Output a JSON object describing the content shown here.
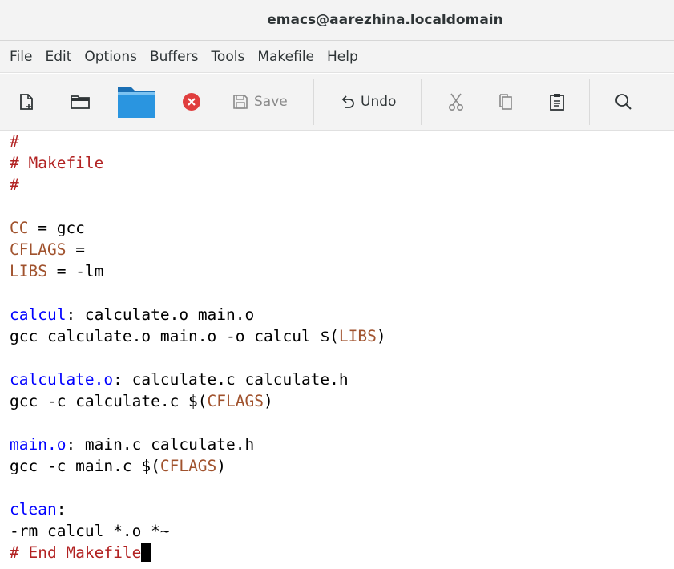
{
  "window": {
    "title": "emacs@aarezhina.localdomain"
  },
  "menu": [
    "File",
    "Edit",
    "Options",
    "Buffers",
    "Tools",
    "Makefile",
    "Help"
  ],
  "toolbar": {
    "new_file_icon": "new-file-icon",
    "open_icon": "folder-icon",
    "dired_icon": "folder-blue-icon",
    "close_icon": "close-circle-icon",
    "save_label": "Save",
    "undo_label": "Undo",
    "cut_icon": "scissors-icon",
    "copy_icon": "copy-icon",
    "paste_icon": "clipboard-icon",
    "search_icon": "search-icon"
  },
  "colors": {
    "comment": "#b22222",
    "variable": "#a0522d",
    "target": "#0000ff",
    "close_button": "#e03e3e",
    "folder_blue": "#1f8ad6"
  },
  "editor": {
    "lines": [
      {
        "comment": "#"
      },
      {
        "comment": "# Makefile"
      },
      {
        "comment": "#"
      },
      {
        "blank": ""
      },
      {
        "var": "CC",
        "rest": " = gcc"
      },
      {
        "var": "CFLAGS",
        "rest": " ="
      },
      {
        "var": "LIBS",
        "rest": " = -lm"
      },
      {
        "blank": ""
      },
      {
        "target": "calcul",
        "rest": ": calculate.o main.o"
      },
      {
        "pre": "gcc calculate.o main.o -o calcul $(",
        "var": "LIBS",
        "post": ")"
      },
      {
        "blank": ""
      },
      {
        "target": "calculate.o",
        "rest": ": calculate.c calculate.h"
      },
      {
        "pre": "gcc -c calculate.c $(",
        "var": "CFLAGS",
        "post": ")"
      },
      {
        "blank": ""
      },
      {
        "target": "main.o",
        "rest": ": main.c calculate.h"
      },
      {
        "pre": "gcc -c main.c $(",
        "var": "CFLAGS",
        "post": ")"
      },
      {
        "blank": ""
      },
      {
        "target": "clean",
        "rest": ":"
      },
      {
        "text": "-rm calcul *.o *~"
      },
      {
        "comment": "# End Makefile"
      }
    ]
  }
}
